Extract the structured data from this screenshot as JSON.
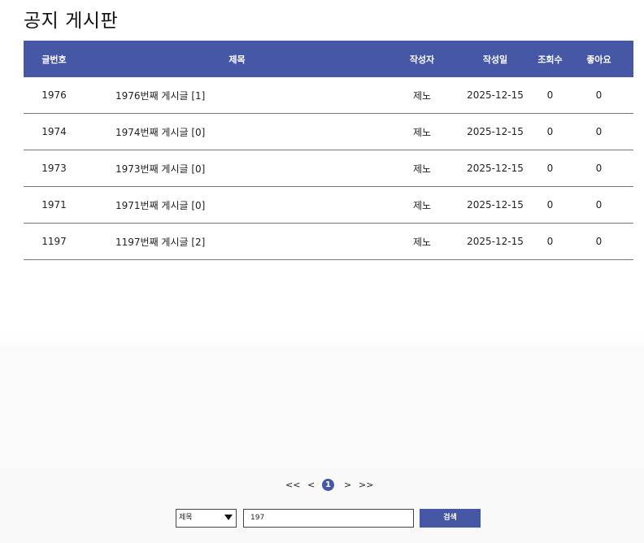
{
  "page": {
    "title": "공지 게시판"
  },
  "table": {
    "headers": {
      "number": "글번호",
      "title": "제목",
      "author": "작성자",
      "date": "작성일",
      "views": "조회수",
      "likes": "좋아요"
    },
    "rows": [
      {
        "number": "1976",
        "title": "1976번째 게시글 [1]",
        "author": "제노",
        "date": "2025-12-15",
        "views": "0",
        "likes": "0"
      },
      {
        "number": "1974",
        "title": "1974번째 게시글 [0]",
        "author": "제노",
        "date": "2025-12-15",
        "views": "0",
        "likes": "0"
      },
      {
        "number": "1973",
        "title": "1973번째 게시글 [0]",
        "author": "제노",
        "date": "2025-12-15",
        "views": "0",
        "likes": "0"
      },
      {
        "number": "1971",
        "title": "1971번째 게시글 [0]",
        "author": "제노",
        "date": "2025-12-15",
        "views": "0",
        "likes": "0"
      },
      {
        "number": "1197",
        "title": "1197번째 게시글 [2]",
        "author": "제노",
        "date": "2025-12-15",
        "views": "0",
        "likes": "0"
      }
    ]
  },
  "pagination": {
    "first": "<<",
    "prev": "<",
    "current": "1",
    "next": ">",
    "last": ">>"
  },
  "search": {
    "field": "제목",
    "query": "197",
    "button": "검색"
  },
  "colors": {
    "accent": "#4657a6"
  }
}
